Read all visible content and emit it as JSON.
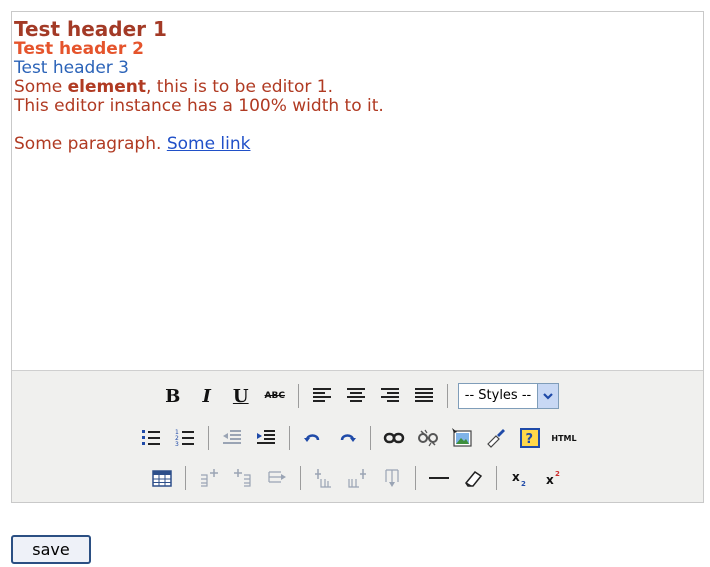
{
  "editor": {
    "content": {
      "header1": "Test header 1",
      "header2": "Test header 2",
      "header3": "Test header 3",
      "line1_pre": "Some ",
      "line1_bold": "element",
      "line1_post": ", this is to be editor 1.",
      "line2": "This editor instance has a 100% width to it.",
      "para_text": "Some paragraph. ",
      "link_text": "Some link"
    },
    "toolbar": {
      "bold_label": "B",
      "italic_label": "I",
      "underline_label": "U",
      "strike_label": "ABC",
      "styles_value": "-- Styles --",
      "html_label": "HTML"
    }
  },
  "save_label": "save",
  "colors": {
    "header1": "#a33a26",
    "header2": "#e5542c",
    "header3": "#2b63b8",
    "text": "#b03a22",
    "link": "#2050c8",
    "toolbar_bg": "#f0f0ee",
    "icon_blue": "#1f4aa8"
  }
}
